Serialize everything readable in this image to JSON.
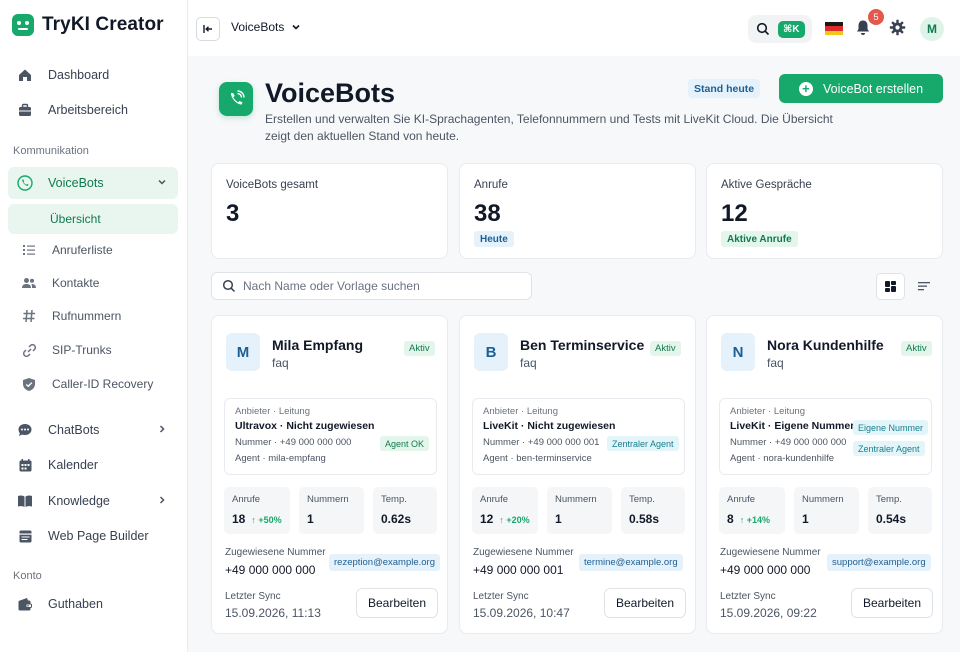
{
  "brand": {
    "name": "TryKI Creator"
  },
  "sidebar": {
    "items": [
      {
        "label": "Dashboard",
        "icon": "home-icon"
      },
      {
        "label": "Arbeitsbereich",
        "icon": "briefcase-icon"
      }
    ],
    "section_kommunikation": "Kommunikation",
    "voicebots": {
      "label": "VoiceBots",
      "icon": "phone-icon"
    },
    "sub_items": [
      {
        "label": "Übersicht"
      },
      {
        "label": "Anruferliste",
        "icon": "list-icon"
      },
      {
        "label": "Kontakte",
        "icon": "contacts-icon"
      },
      {
        "label": "Rufnummern",
        "icon": "hash-icon"
      },
      {
        "label": "SIP-Trunks",
        "icon": "link-icon"
      },
      {
        "label": "Caller-ID Recovery",
        "icon": "shield-icon"
      }
    ],
    "more_items": [
      {
        "label": "ChatBots",
        "icon": "chat-icon"
      },
      {
        "label": "Kalender",
        "icon": "calendar-icon"
      },
      {
        "label": "Knowledge",
        "icon": "book-icon"
      },
      {
        "label": "Web Page Builder",
        "icon": "page-builder-icon"
      }
    ],
    "section_konto": "Konto",
    "konto_items": [
      {
        "label": "Guthaben",
        "icon": "wallet-icon"
      }
    ]
  },
  "topbar": {
    "breadcrumb": "VoiceBots",
    "shortcut": "⌘K",
    "notification_count": "5",
    "avatar_initial": "M"
  },
  "header": {
    "title": "VoiceBots",
    "description": "Erstellen und verwalten Sie KI-Sprachagenten, Telefonnummern und Tests mit LiveKit Cloud. Die Übersicht zeigt den aktuellen Stand von heute.",
    "stand_badge": "Stand heute",
    "create_button": "VoiceBot erstellen"
  },
  "stats": [
    {
      "label": "VoiceBots gesamt",
      "value": "3"
    },
    {
      "label": "Anrufe",
      "value": "38",
      "tag": "Heute"
    },
    {
      "label": "Aktive Gespräche",
      "value": "12",
      "tag": "Aktive Anrufe"
    }
  ],
  "search": {
    "placeholder": "Nach Name oder Vorlage suchen",
    "value": ""
  },
  "labels": {
    "anbieter_leitung": "Anbieter · Leitung",
    "anrufe": "Anrufe",
    "nummern": "Nummern",
    "temp": "Temp.",
    "zugewiesene_nummer": "Zugewiesene Nummer",
    "letzter_sync": "Letzter Sync",
    "bearbeiten": "Bearbeiten"
  },
  "bots": [
    {
      "initial": "M",
      "name": "Mila Empfang",
      "template": "faq",
      "status": "Aktiv",
      "provider": "Ultravox · Nicht zugewiesen",
      "number_line": "Nummer · +49 000 000 000",
      "agent_line": "Agent · mila-empfang",
      "tags": [
        "Agent OK"
      ],
      "calls": "18",
      "trend": "↑ +50%",
      "numbers": "1",
      "temp": "0.62s",
      "assigned_number": "+49 000 000 000",
      "email": "rezeption@example.org",
      "last_sync": "15.09.2026, 11:13"
    },
    {
      "initial": "B",
      "name": "Ben Terminservice",
      "template": "faq",
      "status": "Aktiv",
      "provider": "LiveKit · Nicht zugewiesen",
      "number_line": "Nummer · +49 000 000 001",
      "agent_line": "Agent · ben-terminservice",
      "tags": [
        "Zentraler Agent"
      ],
      "calls": "12",
      "trend": "↑ +20%",
      "numbers": "1",
      "temp": "0.58s",
      "assigned_number": "+49 000 000 001",
      "email": "termine@example.org",
      "last_sync": "15.09.2026, 10:47"
    },
    {
      "initial": "N",
      "name": "Nora Kundenhilfe",
      "template": "faq",
      "status": "Aktiv",
      "provider": "LiveKit · Eigene Nummer",
      "number_line": "Nummer · +49 000 000 000",
      "agent_line": "Agent · nora-kundenhilfe",
      "tags": [
        "Eigene Nummer",
        "Zentraler Agent"
      ],
      "calls": "8",
      "trend": "↑ +14%",
      "numbers": "1",
      "temp": "0.54s",
      "assigned_number": "+49 000 000 000",
      "email": "support@example.org",
      "last_sync": "15.09.2026, 09:22"
    }
  ],
  "colors": {
    "brand": "#17a86b",
    "active_bg": "#e8f6ef",
    "blue_tag": "#e6f2fb",
    "notification": "#e4574b"
  }
}
